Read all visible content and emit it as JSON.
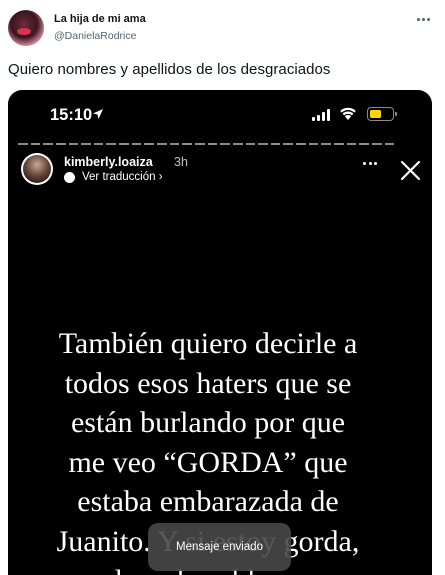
{
  "tweet": {
    "display_name": "La hija de mi ama",
    "handle": "@DanielaRodrice",
    "text": "Quiero nombres y apellidos de los desgraciados"
  },
  "story": {
    "status_time": "15:10",
    "username": "kimberly.loaiza",
    "time_ago": "3h",
    "translate_label": "Ver traducción",
    "text_lines": [
      "También quiero decirle a",
      "todos esos haters que se",
      "están burlando por que",
      "me veo “GORDA” que",
      "estaba embarazada de",
      "Juanito. Y si estoy gorda,",
      "¿cual es el problema con"
    ],
    "toast": "Mensaje enviado",
    "progress_segments": 30
  },
  "icons": {
    "more": "more-horizontal-icon",
    "location": "location-arrow-icon",
    "signal": "cellular-signal-icon",
    "wifi": "wifi-icon",
    "battery": "battery-icon",
    "translate": "translate-icon",
    "close": "close-icon"
  },
  "colors": {
    "battery_fill": "#ffd60a",
    "story_background": "#000000",
    "handle_gray": "#536471"
  }
}
